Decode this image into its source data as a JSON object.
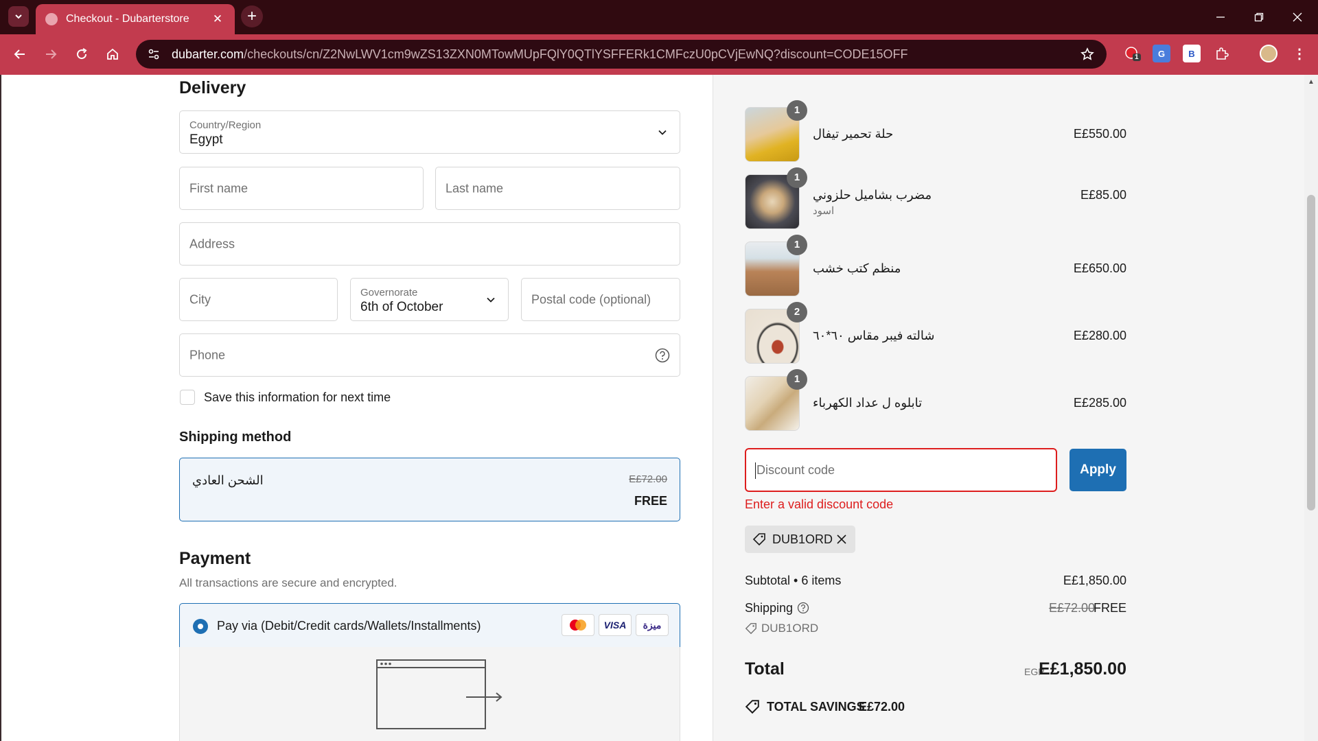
{
  "browser": {
    "tab_title": "Checkout - Dubarterstore",
    "url_host": "dubarter.com",
    "url_path": "/checkouts/cn/Z2NwLWV1cm9wZS13ZXN0MTowMUpFQlY0QTlYSFFERk1CMFczU0pCVjEwNQ?discount=CODE15OFF",
    "extension_badge": "1",
    "extension_b_label": "B",
    "new_tab_symbol": "+",
    "colors": {
      "tab_strip": "#300a10",
      "toolbar": "#c23b4e",
      "omnibox": "#2e0a12"
    }
  },
  "delivery": {
    "heading": "Delivery",
    "country_label": "Country/Region",
    "country_value": "Egypt",
    "first_name_placeholder": "First name",
    "last_name_placeholder": "Last name",
    "address_placeholder": "Address",
    "city_placeholder": "City",
    "governorate_label": "Governorate",
    "governorate_value": "6th of October",
    "postal_placeholder": "Postal code (optional)",
    "phone_placeholder": "Phone",
    "save_info_label": "Save this information for next time"
  },
  "shipping_method": {
    "heading": "Shipping method",
    "option_name": "الشحن العادي",
    "original_price": "E£72.00",
    "price": "FREE"
  },
  "payment": {
    "heading": "Payment",
    "subtitle": "All transactions are secure and encrypted.",
    "option_label": "Pay via (Debit/Credit cards/Wallets/Installments)",
    "card_visa": "VISA",
    "card_meeza": "ميزة"
  },
  "order_summary": {
    "items": [
      {
        "name": "حلة تحمير تيفال",
        "variant": "",
        "price": "E£550.00",
        "quantity": "1"
      },
      {
        "name": "مضرب بشاميل حلزوني",
        "variant": "اسود",
        "price": "E£85.00",
        "quantity": "1"
      },
      {
        "name": "منظم كتب خشب",
        "variant": "",
        "price": "E£650.00",
        "quantity": "1"
      },
      {
        "name": "شالته فيبر مقاس ٦٠*٦٠",
        "variant": "",
        "price": "E£280.00",
        "quantity": "2"
      },
      {
        "name": "تابلوه ل عداد الكهرباء",
        "variant": "",
        "price": "E£285.00",
        "quantity": "1"
      }
    ],
    "discount_placeholder": "Discount code",
    "apply_label": "Apply",
    "error_message": "Enter a valid discount code",
    "applied_code": "DUB1ORD",
    "subtotal_label": "Subtotal • 6 items",
    "subtotal_value": "E£1,850.00",
    "shipping_label": "Shipping",
    "shipping_original": "E£72.00",
    "shipping_value": "FREE",
    "shipping_code": "DUB1ORD",
    "total_label": "Total",
    "currency": "EGP",
    "total_value": "E£1,850.00",
    "savings_label": "TOTAL SAVINGS",
    "savings_value": "E£72.00",
    "colors": {
      "accent": "#1e6fb3",
      "error": "#dd1d1d"
    }
  }
}
